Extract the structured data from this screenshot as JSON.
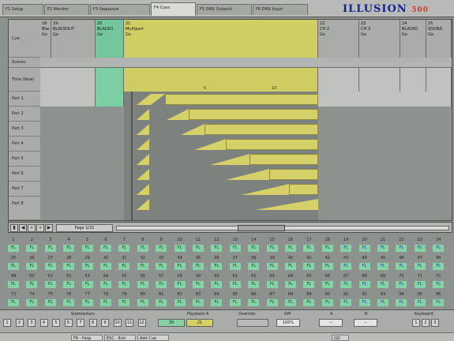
{
  "app": {
    "logo_main": "ILLUSION",
    "logo_sub": "500"
  },
  "tabs": [
    {
      "label": "F1 Setup"
    },
    {
      "label": "F2 Monitor"
    },
    {
      "label": "F3 Sequence"
    },
    {
      "label": "F4 Cues"
    },
    {
      "label": "F5 DMX Outputs"
    },
    {
      "label": "F6 DMX Input"
    }
  ],
  "grid": {
    "row_labels": [
      "Cue",
      "Scenes",
      "Time (Real)",
      "Part 1",
      "Part 2",
      "Part 3",
      "Part 4",
      "Part 5",
      "Part 6",
      "Part 7",
      "Part 8"
    ],
    "cue_headers": [
      {
        "line1": "18",
        "line2": "Blackout",
        "line3": "Go"
      },
      {
        "line1": "19",
        "line2": "BLACKOUT",
        "line3": "Go"
      },
      {
        "line1": "20",
        "line2": "BLACKO",
        "line3": "Go"
      },
      {
        "line1": "21",
        "line2": "Multipart",
        "line3": "Go"
      },
      {
        "line1": "22",
        "line2": "CH 2",
        "line3": "Go"
      },
      {
        "line1": "23",
        "line2": "CH 3",
        "line3": "Go"
      },
      {
        "line1": "24",
        "line2": "BLACKO",
        "line3": "Go"
      },
      {
        "line1": "25",
        "line2": "SOUND",
        "line3": "Go"
      }
    ],
    "time_marks": [
      "5",
      "10"
    ]
  },
  "strip": {
    "page_field": "Page 1/21"
  },
  "channels": {
    "row1_nums": [
      "1",
      "2",
      "3",
      "4",
      "5",
      "6",
      "7",
      "8",
      "9",
      "10",
      "11",
      "12",
      "13",
      "14",
      "15",
      "16",
      "17",
      "18",
      "19",
      "20",
      "21",
      "22",
      "23",
      "24"
    ],
    "row1_vals": [
      "FL",
      "FL",
      "FL",
      "FL",
      "FL",
      "FL",
      "FL",
      "FL",
      "FL",
      "FL",
      "FL",
      "FL",
      "FL",
      "FL",
      "FL",
      "FL",
      "FL",
      "FL",
      "FL",
      "FL",
      "FL",
      "FL",
      "FL",
      "FL"
    ],
    "row2_nums": [
      "25",
      "26",
      "27",
      "28",
      "29",
      "30",
      "31",
      "32",
      "33",
      "34",
      "35",
      "36",
      "37",
      "38",
      "39",
      "40",
      "41",
      "42",
      "43",
      "44",
      "45",
      "46",
      "47",
      "48"
    ],
    "row2_vals": [
      "FL",
      "FL",
      "FL",
      "FL",
      "FL",
      "FL",
      "FL",
      "FL",
      "FL",
      "FL",
      "FL",
      "FL",
      "FL",
      "FL",
      "FL",
      "FL",
      "FL",
      "FL",
      "FL",
      "FL",
      "FL",
      "FL",
      "FL",
      "FL"
    ],
    "row3_nums": [
      "49",
      "50",
      "51",
      "52",
      "53",
      "54",
      "55",
      "56",
      "57",
      "58",
      "59",
      "60",
      "61",
      "62",
      "63",
      "64",
      "65",
      "66",
      "67",
      "68",
      "69",
      "70",
      "71",
      "72"
    ],
    "row3_vals": [
      "FL",
      "FL",
      "FL",
      "FL",
      "FL",
      "FL",
      "FL",
      "FL",
      "FL",
      "FL",
      "FL",
      "FL",
      "FL",
      "FL",
      "FL",
      "FL",
      "FL",
      "FL",
      "FL",
      "FL",
      "FL",
      "FL",
      "FL",
      "FL"
    ],
    "row4_nums": [
      "73",
      "74",
      "75",
      "76",
      "77",
      "78",
      "79",
      "80",
      "81",
      "82",
      "83",
      "84",
      "85",
      "86",
      "87",
      "88",
      "89",
      "90",
      "91",
      "92",
      "93",
      "94",
      "95",
      "96"
    ],
    "row4_vals": [
      "FL",
      "FL",
      "FL",
      "FL",
      "FL",
      "FL",
      "FL",
      "FL",
      "FL",
      "FL",
      "FL",
      "FL",
      "FL",
      "FL",
      "FL",
      "FL",
      "FL",
      "FL",
      "FL",
      "FL",
      "FL",
      "FL",
      "FL",
      "FL"
    ]
  },
  "bottom": {
    "submasters_label": "Submasters",
    "playback_label": "Playback A",
    "override_label": "Override",
    "gm_label": "GM",
    "a_label": "A",
    "b_label": "B",
    "keypad_label": "Keyboard",
    "submaster_keys": [
      "1",
      "2",
      "3",
      "4",
      "5",
      "6",
      "7",
      "8",
      "9",
      "10",
      "11",
      "12"
    ],
    "playback_a_value": "20",
    "playback_b_value": "21",
    "gm_value": "100%",
    "a_value": "--",
    "b_value": "--",
    "keypad_keys": [
      "1",
      "2",
      "3"
    ]
  },
  "status": {
    "items": [
      "F8 - Help",
      "ESC - Exit",
      "Add Cue",
      "GO"
    ]
  },
  "colors": {
    "cue_selected": "#73c79a",
    "cue_multipart": "#cfce63",
    "fade_bar": "#d5d168",
    "channel_bg": "#86d2a7"
  }
}
